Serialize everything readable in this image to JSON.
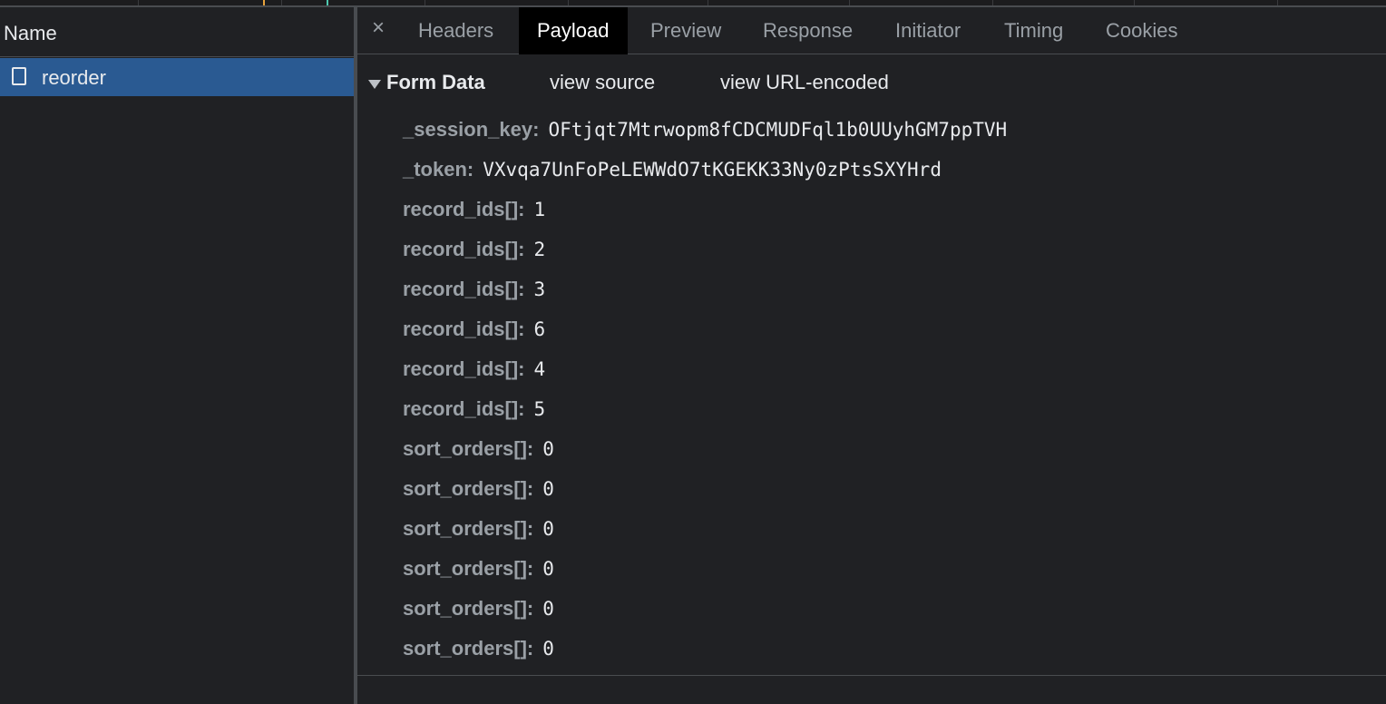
{
  "network_list": {
    "column_header": "Name",
    "requests": [
      {
        "name": "reorder",
        "icon": "document-icon"
      }
    ]
  },
  "detail": {
    "close_glyph": "×",
    "tabs": [
      {
        "label": "Headers",
        "active": false
      },
      {
        "label": "Payload",
        "active": true
      },
      {
        "label": "Preview",
        "active": false
      },
      {
        "label": "Response",
        "active": false
      },
      {
        "label": "Initiator",
        "active": false
      },
      {
        "label": "Timing",
        "active": false
      },
      {
        "label": "Cookies",
        "active": false
      }
    ],
    "form_data": {
      "title": "Form Data",
      "view_source_label": "view source",
      "view_url_encoded_label": "view URL-encoded",
      "fields": [
        {
          "key": "_session_key:",
          "value": "OFtjqt7Mtrwopm8fCDCMUDFql1b0UUyhGM7ppTVH"
        },
        {
          "key": "_token:",
          "value": "VXvqa7UnFoPeLEWWdO7tKGEKK33Ny0zPtsSXYHrd"
        },
        {
          "key": "record_ids[]:",
          "value": "1"
        },
        {
          "key": "record_ids[]:",
          "value": "2"
        },
        {
          "key": "record_ids[]:",
          "value": "3"
        },
        {
          "key": "record_ids[]:",
          "value": "6"
        },
        {
          "key": "record_ids[]:",
          "value": "4"
        },
        {
          "key": "record_ids[]:",
          "value": "5"
        },
        {
          "key": "sort_orders[]:",
          "value": "0"
        },
        {
          "key": "sort_orders[]:",
          "value": "0"
        },
        {
          "key": "sort_orders[]:",
          "value": "0"
        },
        {
          "key": "sort_orders[]:",
          "value": "0"
        },
        {
          "key": "sort_orders[]:",
          "value": "0"
        },
        {
          "key": "sort_orders[]:",
          "value": "0"
        }
      ]
    }
  },
  "colors": {
    "background": "#202124",
    "selected_row": "#2a5a92",
    "active_tab": "#000000",
    "text": "#e8eaed",
    "muted": "#9aa0a6"
  }
}
